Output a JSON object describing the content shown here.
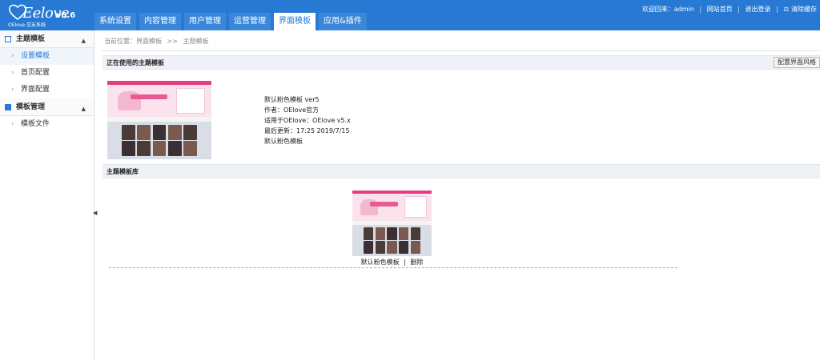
{
  "app": {
    "brand": "Eelove",
    "brand_sub": "OElove 交友系统",
    "version": "v5.6",
    "colors": {
      "topbar": "#2779d3",
      "accent": "#e63d82"
    }
  },
  "tabs": [
    {
      "label": "系统设置"
    },
    {
      "label": "内容管理"
    },
    {
      "label": "用户管理"
    },
    {
      "label": "运营管理"
    },
    {
      "label": "界面模板",
      "active": true
    },
    {
      "label": "应用&插件"
    }
  ],
  "toplinks": {
    "welcome": "欢迎回来：admin",
    "home": "网站首页",
    "logout": "退出登录",
    "clear_cache": "清除缓存"
  },
  "sidebar": {
    "groups": [
      {
        "title": "主题模板",
        "icon": "square-outline-icon",
        "items": [
          {
            "label": "设置模板",
            "active": true
          },
          {
            "label": "首页配置"
          },
          {
            "label": "界面配置"
          }
        ]
      },
      {
        "title": "模板管理",
        "icon": "grid-square-icon",
        "items": [
          {
            "label": "模板文件"
          }
        ]
      }
    ]
  },
  "breadcrumb": {
    "prefix": "当前位置：界面模板",
    "separator": ">>",
    "current": "主题模板"
  },
  "current_theme": {
    "section_title": "正在使用的主题模板",
    "config_button": "配置界面风格",
    "name": "默认粉色模板 ver5",
    "author": "作者：OElove官方",
    "applies_to": "适用于OElove：OElove v5.x",
    "updated": "最后更新：17:25 2019/7/15",
    "description": "默认粉色模板"
  },
  "library": {
    "section_title": "主题模板库",
    "items": [
      {
        "name": "默认粉色模板",
        "delete_label": "删除"
      }
    ],
    "action_separator": "|"
  }
}
